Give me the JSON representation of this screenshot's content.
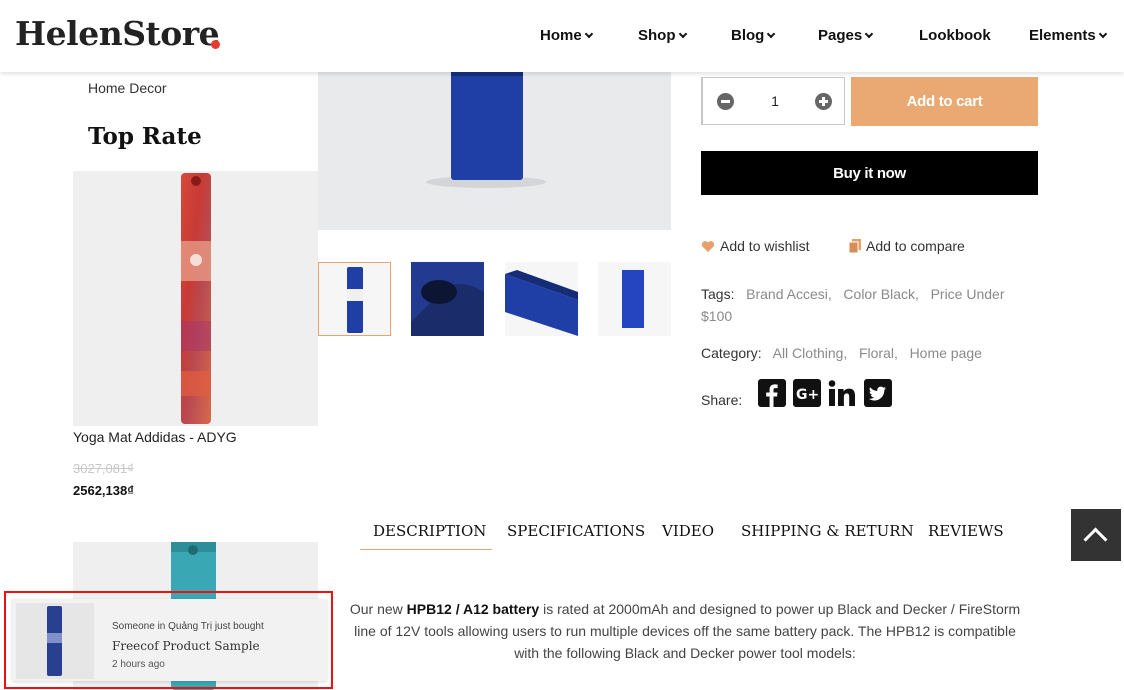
{
  "header": {
    "logo_text": "HelenStore",
    "nav": [
      {
        "label": "Home",
        "has_dropdown": true
      },
      {
        "label": "Shop",
        "has_dropdown": true
      },
      {
        "label": "Blog",
        "has_dropdown": true
      },
      {
        "label": "Pages",
        "has_dropdown": true
      },
      {
        "label": "Lookbook",
        "has_dropdown": false
      },
      {
        "label": "Elements",
        "has_dropdown": true
      }
    ]
  },
  "sidebar": {
    "category_link": "Home Decor",
    "heading": "Top Rate",
    "products": [
      {
        "title": "Yoga Mat Addidas - ADYG",
        "old_price": "3027,081₫",
        "price": "2562,138₫"
      }
    ]
  },
  "product": {
    "quantity": "1",
    "add_to_cart_label": "Add to cart",
    "buy_now_label": "Buy it now",
    "wishlist_label": "Add to wishlist",
    "compare_label": "Add to compare",
    "tags_label": "Tags:",
    "tags": [
      "Brand Accesi,",
      "Color Black,",
      "Price Under $100"
    ],
    "category_label": "Category:",
    "categories": [
      "All Clothing,",
      "Floral,",
      "Home page"
    ],
    "share_label": "Share:",
    "share_icons": [
      "facebook-icon",
      "google-plus-icon",
      "linkedin-icon",
      "twitter-icon"
    ]
  },
  "tabs": [
    {
      "label": "DESCRIPTION",
      "active": true
    },
    {
      "label": "SPECIFICATIONS",
      "active": false
    },
    {
      "label": "VIDEO",
      "active": false
    },
    {
      "label": "SHIPPING & RETURN",
      "active": false
    },
    {
      "label": "REVIEWS",
      "active": false
    }
  ],
  "description": {
    "prefix": "Our new ",
    "bold": "HPB12 / A12 battery",
    "rest": " is rated at 2000mAh and designed to power up Black and Decker / FireStorm line of 12V tools allowing users to run multiple devices off the same battery pack. The HPB12 is compatible with the following Black and Decker power tool models:"
  },
  "notification": {
    "line1": "Someone in Quảng Trị just bought",
    "product": "Freecof Product Sample",
    "time": "2 hours ago"
  },
  "colors": {
    "accent": "#eaa872",
    "logo_dot": "#e63b2e",
    "mat_blue": "#1f3fa6",
    "highlight_border": "#ee1111"
  }
}
